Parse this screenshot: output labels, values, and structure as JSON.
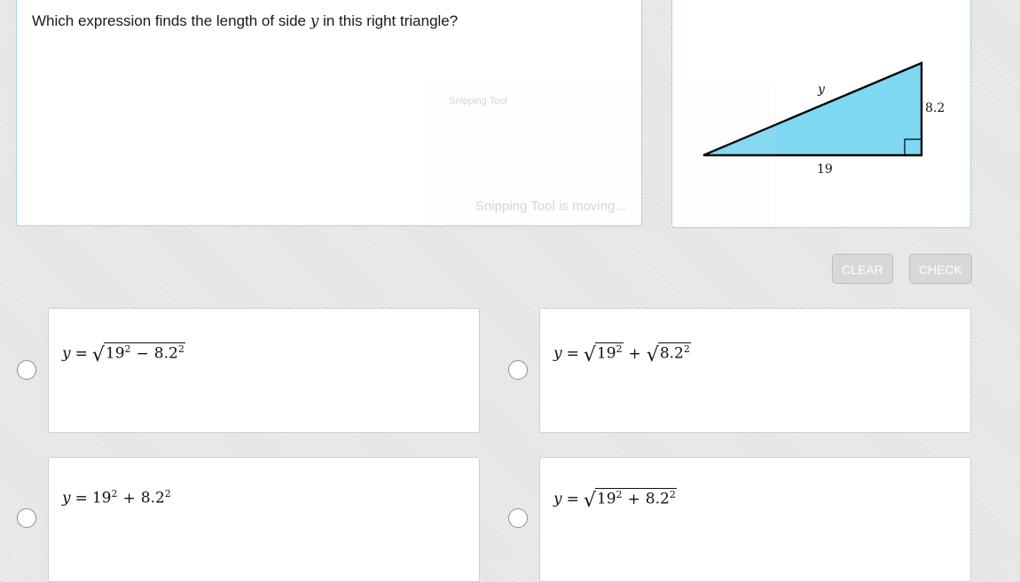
{
  "question": {
    "prefix": "Which expression finds the length of side ",
    "variable": "y",
    "suffix": " in this right triangle?"
  },
  "figure": {
    "label_hypotenuse": "y",
    "label_vertical": "8.2",
    "label_horizontal": "19",
    "fill_color": "#7fd8f1"
  },
  "ghost_window": {
    "title": "Snipping Tool",
    "status": "Snipping Tool is moving..."
  },
  "buttons": {
    "clear_label": "CLEAR",
    "check_label": "CHECK"
  },
  "choices": [
    {
      "id": "a",
      "lhs": "y",
      "eq": "=",
      "parts": [
        "sqrt(19^2 − 8.2^2)"
      ]
    },
    {
      "id": "b",
      "lhs": "y",
      "eq": "=",
      "parts": [
        "sqrt(19^2)",
        "+",
        "sqrt(8.2^2)"
      ]
    },
    {
      "id": "c",
      "lhs": "y",
      "eq": "=",
      "parts": [
        "19^2",
        "+",
        "8.2^2"
      ]
    },
    {
      "id": "d",
      "lhs": "y",
      "eq": "=",
      "parts": [
        "sqrt(19^2 + 8.2^2)"
      ]
    }
  ],
  "math": {
    "a": {
      "base1": "19",
      "exp1": "2",
      "op": "−",
      "base2": "8.2",
      "exp2": "2"
    },
    "b": {
      "base1": "19",
      "exp1": "2",
      "op": "+",
      "base2": "8.2",
      "exp2": "2"
    },
    "c": {
      "base1": "19",
      "exp1": "2",
      "op": "+",
      "base2": "8.2",
      "exp2": "2"
    },
    "d": {
      "base1": "19",
      "exp1": "2",
      "op": "+",
      "base2": "8.2",
      "exp2": "2"
    }
  },
  "colors": {
    "card_border": "#a9d3e3",
    "button_bg": "#d8d8d8",
    "triangle_fill": "#7fd8f1"
  }
}
